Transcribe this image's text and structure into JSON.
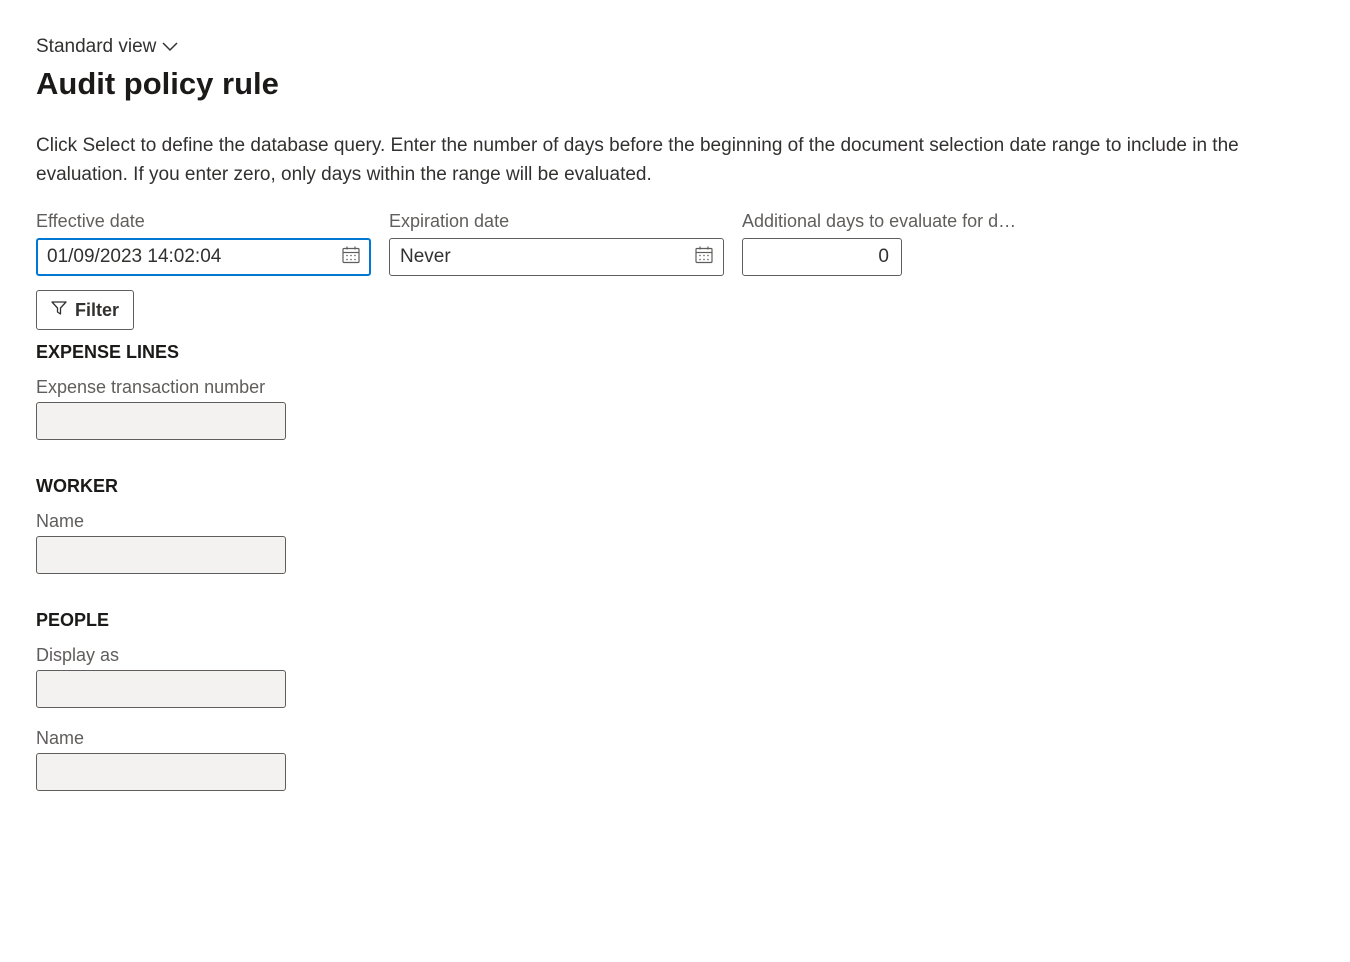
{
  "view_selector": {
    "label": "Standard view"
  },
  "page_title": "Audit policy rule",
  "description": "Click Select to define the database query. Enter the number of days before the beginning of the document selection date range to include in the evaluation. If you enter zero, only days within the range will be evaluated.",
  "fields": {
    "effective_date": {
      "label": "Effective date",
      "value": "01/09/2023 14:02:04"
    },
    "expiration_date": {
      "label": "Expiration date",
      "value": "Never"
    },
    "additional_days": {
      "label": "Additional days to evaluate for d…",
      "value": "0"
    }
  },
  "filter_btn": {
    "label": "Filter"
  },
  "sections": {
    "expense_lines": {
      "heading": "EXPENSE LINES",
      "fields": {
        "expense_transaction_number": {
          "label": "Expense transaction number",
          "value": ""
        }
      }
    },
    "worker": {
      "heading": "WORKER",
      "fields": {
        "name": {
          "label": "Name",
          "value": ""
        }
      }
    },
    "people": {
      "heading": "PEOPLE",
      "fields": {
        "display_as": {
          "label": "Display as",
          "value": ""
        },
        "name": {
          "label": "Name",
          "value": ""
        }
      }
    }
  }
}
